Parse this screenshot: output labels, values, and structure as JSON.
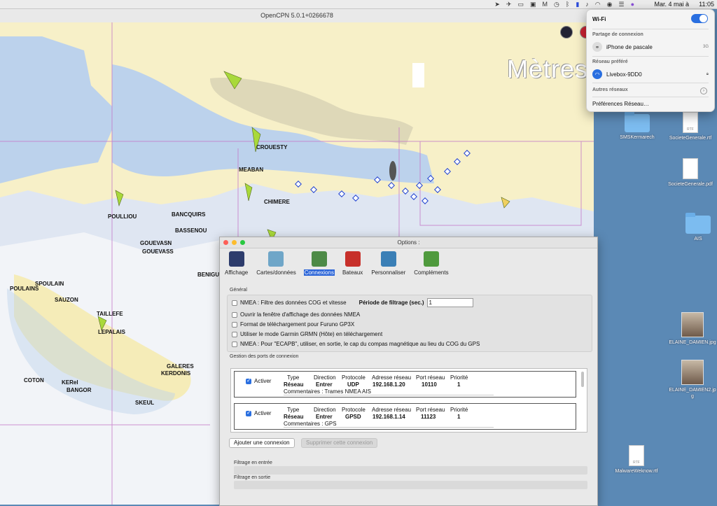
{
  "menubar": {
    "icons": [
      "location-icon",
      "send-icon",
      "battery-status-icon",
      "display-icon",
      "malwarebytes-icon",
      "time-machine-icon",
      "bluetooth-icon",
      "flag-icon",
      "sound-icon",
      "wifi-icon",
      "user-icon",
      "control-center-icon",
      "siri-icon"
    ],
    "date": "Mar. 4 mai à",
    "time": "11:05"
  },
  "chart_window": {
    "title": "OpenCPN 5.0.1+0266678",
    "watermark": "Mètres",
    "places": [
      {
        "name": "CROUESTY"
      },
      {
        "name": "MEABAN"
      },
      {
        "name": "CHIMERE"
      },
      {
        "name": "POULLIOU"
      },
      {
        "name": "BANCQUIRS"
      },
      {
        "name": "BASSENOU"
      },
      {
        "name": "GOUEVASN"
      },
      {
        "name": "GOUEVASS"
      },
      {
        "name": "BENIGUET"
      },
      {
        "name": "POULAINS"
      },
      {
        "name": "SPOULAIN"
      },
      {
        "name": "SAUZON"
      },
      {
        "name": "TAILLEFE"
      },
      {
        "name": "LEPALAIS"
      },
      {
        "name": "GALERES"
      },
      {
        "name": "KERDONIS"
      },
      {
        "name": "COTON"
      },
      {
        "name": "KERel"
      },
      {
        "name": "BANGOR"
      },
      {
        "name": "SKEUL"
      }
    ]
  },
  "options": {
    "title": "Options :",
    "tabs": [
      {
        "label": "Affichage",
        "icon": "display-monitor-icon",
        "color": "#2d3c6c"
      },
      {
        "label": "Cartes/données",
        "icon": "charts-icon",
        "color": "#6fa6c8"
      },
      {
        "label": "Connexions",
        "icon": "connections-icon",
        "color": "#4d8a46",
        "active": true
      },
      {
        "label": "Bateaux",
        "icon": "ship-icon",
        "color": "#c7302a"
      },
      {
        "label": "Personnaliser",
        "icon": "sliders-icon",
        "color": "#3a7fb6"
      },
      {
        "label": "Compléments",
        "icon": "puzzle-icon",
        "color": "#4f9a3d"
      }
    ],
    "general_label": "Général",
    "general": {
      "nmea_filter_label": "NMEA : Filtre des données COG et vitesse",
      "filter_period_label": "Période de filtrage (sec.)",
      "filter_period_value": "1",
      "open_window_label": "Ouvrir la fenêtre d'affichage des données NMEA",
      "furuno_label": "Format de téléchargement pour Furuno GP3X",
      "garmin_label": "Utiliser le mode Garmin GRMN (Hôte) en téléchargement",
      "ecapb_label": "NMEA : Pour \"ECAPB\", utiliser, en sortie, le cap du compas magnétique  au lieu du COG du GPS"
    },
    "ports_label": "Gestion des ports de connexion",
    "connections_headers": {
      "enable": "Activer",
      "type": "Type",
      "direction": "Direction",
      "protocol": "Protocole",
      "address": "Adresse réseau",
      "port": "Port réseau",
      "priority": "Priorité",
      "comments": "Commentaires :"
    },
    "connections": [
      {
        "enabled": true,
        "type": "Réseau",
        "direction": "Entrer",
        "protocol": "UDP",
        "address": "192.168.1.20",
        "port": "10110",
        "priority": "1",
        "comment": "Trames NMEA AIS"
      },
      {
        "enabled": true,
        "type": "Réseau",
        "direction": "Entrer",
        "protocol": "GPSD",
        "address": "192.168.1.14",
        "port": "11123",
        "priority": "1",
        "comment": "GPS"
      }
    ],
    "add_button": "Ajouter une connexion",
    "remove_button": "Supprimer cette connexion",
    "filter_in_label": "Filtrage en entrée",
    "filter_out_label": "Filtrage en sortie"
  },
  "desktop": {
    "icons": [
      {
        "label": "SMSKermarech",
        "kind": "folder"
      },
      {
        "label": "SocieteGenerale.rtf",
        "kind": "rtf"
      },
      {
        "label": "SocieteGenerale.pdf",
        "kind": "pdf"
      },
      {
        "label": "AIS",
        "kind": "folder"
      },
      {
        "label": "ELAINE_DAMIEN.jpg",
        "kind": "photo"
      },
      {
        "label": "ELAINE_DAMIEN2.jpg",
        "kind": "photo"
      },
      {
        "label": "MalwareWeknow.rtf",
        "kind": "rtf"
      }
    ]
  },
  "wifi_panel": {
    "title": "Wi-Fi",
    "enabled": true,
    "hotspot_label": "Partage de connexion",
    "hotspot_device": "iPhone de pascale",
    "hotspot_signal": "3G",
    "preferred_label": "Réseau préféré",
    "preferred_network": "Livebox-9DD0",
    "other_networks": "Autres réseaux",
    "preferences": "Préférences Réseau…"
  }
}
